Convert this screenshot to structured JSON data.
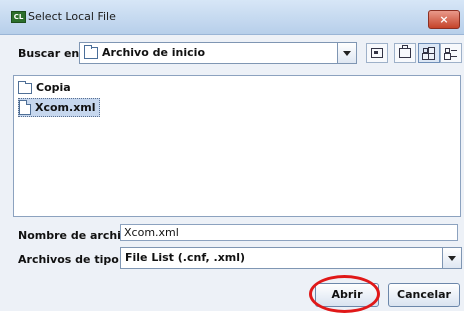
{
  "window": {
    "title": "Select Local File",
    "app_icon_text": "CL",
    "close_glyph": "×"
  },
  "lookin": {
    "label": "Buscar en:",
    "value": "Archivo de inicio",
    "icon": "folder-icon"
  },
  "toolbar": {
    "buttons": [
      {
        "name": "home-folder",
        "icon": "home-icon"
      },
      {
        "name": "new-folder",
        "icon": "new-folder-icon"
      },
      {
        "name": "list-view",
        "icon": "list-view-icon",
        "selected": true
      },
      {
        "name": "details-view",
        "icon": "details-view-icon"
      }
    ]
  },
  "files": [
    {
      "label": "Copia",
      "type": "folder",
      "icon": "folder-icon",
      "selected": false
    },
    {
      "label": "Xcom.xml",
      "type": "file",
      "icon": "file-icon",
      "selected": true
    }
  ],
  "filename": {
    "label": "Nombre de archivo:",
    "value": "Xcom.xml"
  },
  "filetype": {
    "label": "Archivos de tipo:",
    "value": "File List (.cnf, .xml)"
  },
  "buttons": {
    "open_label": "Abrir",
    "cancel_label": "Cancelar"
  },
  "colors": {
    "title_bar": "#c7dbf1",
    "close_button": "#c5432a",
    "selection": "#c6d7ee",
    "highlight_ring": "#e01818"
  }
}
